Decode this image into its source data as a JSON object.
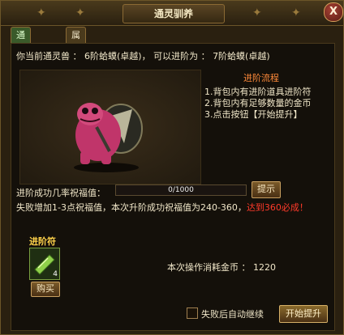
{
  "window": {
    "title": "通灵驯养",
    "close_label": "X"
  },
  "tabs": [
    {
      "label": "通灵进阶",
      "active": true
    },
    {
      "label": "属性提升",
      "active": false
    }
  ],
  "summary": "你当前通灵兽 ： 6阶蛤蟆(卓越)， 可以进阶为 ： 7阶蛤蟆(卓越)",
  "advance_flow": {
    "title": "进阶流程",
    "steps": [
      "1.背包内有进阶道具进阶符",
      "2.背包内有足够数量的金币",
      "3.点击按钮【开始提升】"
    ]
  },
  "bless": {
    "label": "进阶成功几率祝福值：",
    "value_text": "0/1000",
    "progress": 0
  },
  "tip_button": "提示",
  "fail_note": {
    "text": "失败增加1-3点祝福值，本次升阶成功祝福值为240-360，",
    "highlight": "达到360必成！"
  },
  "item": {
    "name": "进阶符",
    "count": "4",
    "buy_label": "购买"
  },
  "cost": "本次操作消耗金币 ： 1220",
  "auto_continue": {
    "label": "失败后自动继续",
    "checked": false
  },
  "start_button": "开始提升",
  "colors": {
    "accent": "#ff8a3a",
    "warning": "#ff3a2a",
    "item_name": "#ffd24a"
  }
}
